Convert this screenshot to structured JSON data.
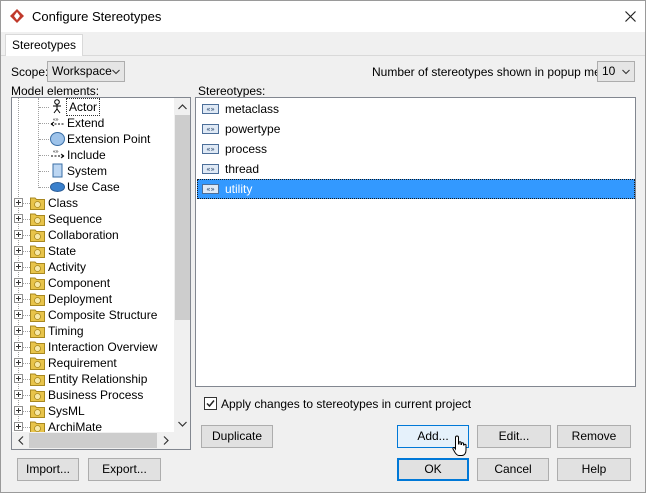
{
  "window": {
    "title": "Configure Stereotypes",
    "tab": "Stereotypes"
  },
  "scope": {
    "label": "Scope:",
    "value": "Workspace"
  },
  "popup": {
    "label": "Number of stereotypes shown in popup menu:",
    "value": "10"
  },
  "model_elements": {
    "label": "Model elements:",
    "children": [
      {
        "label": "Actor",
        "icon": "actor-icon"
      },
      {
        "label": "Extend",
        "icon": "extend-icon"
      },
      {
        "label": "Extension Point",
        "icon": "extension-point-icon"
      },
      {
        "label": "Include",
        "icon": "include-icon"
      },
      {
        "label": "System",
        "icon": "system-icon"
      },
      {
        "label": "Use Case",
        "icon": "use-case-icon"
      }
    ],
    "folders": [
      "Class",
      "Sequence",
      "Collaboration",
      "State",
      "Activity",
      "Component",
      "Deployment",
      "Composite Structure",
      "Timing",
      "Interaction Overview",
      "Requirement",
      "Entity Relationship",
      "Business Process",
      "SysML",
      "ArchiMate"
    ]
  },
  "stereotypes": {
    "label": "Stereotypes:",
    "items": [
      "metaclass",
      "powertype",
      "process",
      "thread",
      "utility"
    ],
    "selected": "utility"
  },
  "apply": {
    "label": "Apply changes to stereotypes in current project",
    "checked": true
  },
  "buttons": {
    "duplicate": "Duplicate",
    "add": "Add...",
    "edit": "Edit...",
    "remove": "Remove",
    "import": "Import...",
    "export": "Export...",
    "ok": "OK",
    "cancel": "Cancel",
    "help": "Help"
  },
  "colors": {
    "selection": "#3399ff",
    "accent": "#0078d7",
    "app_icon": "#c0392b",
    "folder": "#e8c44a"
  }
}
